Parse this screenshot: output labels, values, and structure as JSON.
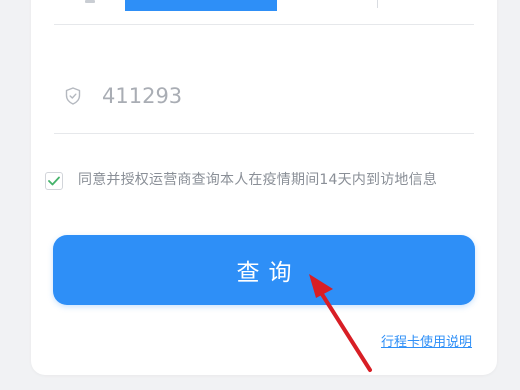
{
  "form": {
    "captcha": {
      "value": "411293",
      "icon": "shield-icon"
    },
    "agreement": {
      "checked": true,
      "text": "同意并授权运营商查询本人在疫情期间14天内到访地信息"
    },
    "query_button_label": "查询",
    "help_link_label": "行程卡使用说明"
  },
  "colors": {
    "accent": "#2e8ff7",
    "annotation_arrow": "#d81e25",
    "checkbox_check": "#45b36b"
  }
}
